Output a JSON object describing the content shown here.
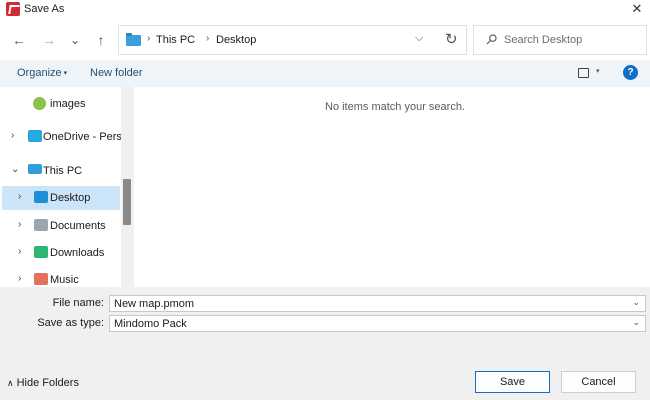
{
  "window": {
    "title": "Save As",
    "close_glyph": "✕"
  },
  "nav": {
    "back_glyph": "←",
    "forward_glyph": "→",
    "recent_glyph": "⌄",
    "up_glyph": "↑",
    "path": [
      "This PC",
      "Desktop"
    ],
    "separator_glyph": "›",
    "dropdown_glyph": "⌵",
    "refresh_glyph": "↻",
    "search_placeholder": "Search Desktop"
  },
  "toolbar": {
    "organize_label": "Organize",
    "organize_caret": "▾",
    "new_folder_label": "New folder",
    "view_caret": "▾",
    "help_glyph": "?"
  },
  "tree": [
    {
      "label": "images",
      "chevron": "",
      "icon": "images-folder-icon",
      "selected": false
    },
    {
      "label": "OneDrive - Perso",
      "chevron": "›",
      "icon": "onedrive-folder-icon",
      "selected": false
    },
    {
      "label": "This PC",
      "chevron": "⌄",
      "icon": "monitor-icon",
      "selected": false
    },
    {
      "label": "Desktop",
      "chevron": "›",
      "icon": "desktop-folder-icon",
      "selected": true
    },
    {
      "label": "Documents",
      "chevron": "›",
      "icon": "documents-folder-icon",
      "selected": false
    },
    {
      "label": "Downloads",
      "chevron": "›",
      "icon": "downloads-folder-icon",
      "selected": false
    },
    {
      "label": "Music",
      "chevron": "›",
      "icon": "music-folder-icon",
      "selected": false
    }
  ],
  "content": {
    "empty_message": "No items match your search."
  },
  "form": {
    "file_name_label": "File name:",
    "file_name_value": "New map.pmom",
    "save_type_label": "Save as type:",
    "save_type_value": "Mindomo Pack",
    "chevron_glyph": "⌄"
  },
  "footer": {
    "hide_folders_caret": "∧",
    "hide_folders_label": "Hide Folders",
    "save_label": "Save",
    "cancel_label": "Cancel"
  },
  "colors": {
    "accent": "#0f6fc6",
    "app_icon": "#d12a36",
    "selection": "#cce4f7",
    "toolbar_bg": "#eff4f9",
    "footer_bg": "#f0f0f0"
  }
}
